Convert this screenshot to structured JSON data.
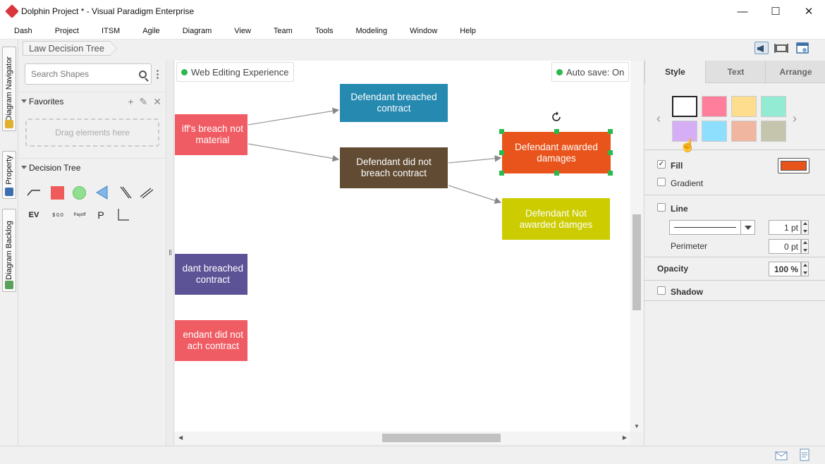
{
  "window": {
    "title": "Dolphin Project * - Visual Paradigm Enterprise",
    "minimize": "—",
    "maximize": "☐",
    "close": "✕"
  },
  "menu": [
    "Dash",
    "Project",
    "ITSM",
    "Agile",
    "Diagram",
    "View",
    "Team",
    "Tools",
    "Modeling",
    "Window",
    "Help"
  ],
  "left_tabs": [
    "Diagram Navigator",
    "Property",
    "Diagram Backlog"
  ],
  "breadcrumb": "Law Decision Tree",
  "shapes_panel": {
    "search_placeholder": "Search Shapes",
    "favorites": "Favorites",
    "drop_hint": "Drag elements here",
    "decision_tree": "Decision Tree",
    "tool_labels": {
      "ev": "EV",
      "money": "$ 0.0",
      "payoff": "Payoff",
      "p": "P"
    }
  },
  "canvas": {
    "web_editing": "Web Editing Experience",
    "auto_save": "Auto save: On",
    "nodes": {
      "plaintiff_breach": "iff's breach not\nmaterial",
      "breached": "Defendant breached\ncontract",
      "did_not_breach": "Defendant did not\nbreach contract",
      "awarded": "Defendant awarded\ndamages",
      "not_awarded": "Defendant Not\nawarded damges",
      "left_breached": "dant breached\ncontract",
      "left_did_not": "endant did not\nach contract"
    },
    "node_colors": {
      "plaintiff_breach": "#f05c63",
      "breached": "#2589b0",
      "did_not_breach": "#614b33",
      "awarded": "#e8541b",
      "not_awarded": "#cccc00",
      "left_breached": "#5c5296",
      "left_did_not": "#f05c63"
    }
  },
  "properties": {
    "tabs": [
      "Style",
      "Text",
      "Arrange"
    ],
    "swatches": [
      "#ffffff",
      "#fe7e9b",
      "#fedd8e",
      "#94ebd3",
      "#d5aef5",
      "#8edffe",
      "#f0b6a0",
      "#c5c5ad"
    ],
    "fill": "Fill",
    "fill_checked": true,
    "fill_color": "#e8541b",
    "gradient": "Gradient",
    "line": "Line",
    "line_weight": "1 pt",
    "perimeter": "Perimeter",
    "perimeter_value": "0 pt",
    "opacity": "Opacity",
    "opacity_value": "100 %",
    "shadow": "Shadow"
  }
}
